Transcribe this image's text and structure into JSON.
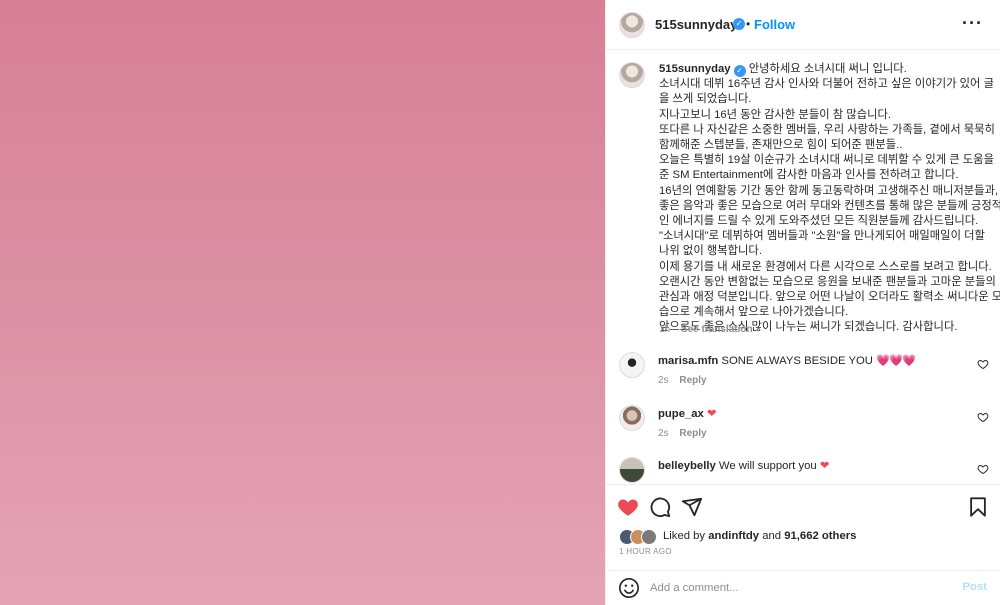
{
  "photo": {
    "colors": [
      "#d77f96",
      "#db8fa3",
      "#e4a4b5"
    ]
  },
  "header": {
    "username": "515sunnyday",
    "verified_icon": "verified-badge-icon",
    "dot": "•",
    "follow_label": "Follow",
    "more_icon": "more-options-icon",
    "more_glyph": "···"
  },
  "caption": {
    "username": "515sunnyday",
    "lines": [
      "안녕하세요 소녀시대 써니 입니다.",
      "소녀시대 데뷔 16주년 감사 인사와 더불어 전하고 싶은 이야기가 있어 글",
      "을 쓰게 되었습니다.",
      "지나고보니 16년 동안 감사한 분들이 참 많습니다.",
      "또다른 나 자신같은 소중한 멤버들, 우리 사랑하는 가족들, 곁에서 묵묵히",
      "함께해준 스텝분들, 존재만으로 힘이 되어준 팬분들..",
      "오늘은 특별히 19살 이순규가 소녀시대 써니로 데뷔할 수 있게 큰 도움을",
      "준 SM Entertainment에 감사한 마음과 인사를 전하려고 합니다.",
      "16년의 연예활동 기간 동안 함께 동고동락하며 고생해주신 매니저분들과,",
      "좋은 음악과 좋은 모습으로 여러 무대와 컨텐츠를 통해 많은 분들께 긍정적",
      "인 에너지를 드릴 수 있게 도와주셨던 모든 직원분들께 감사드립니다.",
      "\"소녀시대\"로 데뷔하여 멤버들과 \"소원\"을 만나게되어 매일매일이 더할",
      "나위 없이 행복합니다.",
      "이제 용기를 내 새로운 환경에서 다른 시각으로 스스로를 보려고 합니다.",
      "오랜시간 동안 변함없는 모습으로 응원을 보내준 팬분들과 고마운 분들의",
      "관심과 애정 덕분입니다. 앞으로 어떤 나날이 오더라도 활력소 써니다운 모",
      "습으로 계속해서 앞으로 나아가겠습니다.",
      "앞으로도 좋은 소식 많이 나누는 써니가 되겠습니다. 감사합니다."
    ],
    "time": "1h",
    "see_translation": "See translation"
  },
  "comments": [
    {
      "username": "marisa.mfn",
      "text": "SONE ALWAYS BESIDE YOU",
      "emoji": "💗💗💗",
      "time": "2s",
      "reply": "Reply"
    },
    {
      "username": "pupe_ax",
      "text": "",
      "emoji": "❤",
      "time": "2s",
      "reply": "Reply"
    },
    {
      "username": "belleybelly",
      "text": "We will support you",
      "emoji": "❤",
      "time": "",
      "reply": ""
    }
  ],
  "actions": {
    "like_icon": "heart-filled-icon",
    "comment_icon": "comment-bubble-icon",
    "share_icon": "share-paper-plane-icon",
    "save_icon": "bookmark-icon",
    "liked_by_prefix": "Liked by",
    "liked_by_user": "andinftdy",
    "and": "and",
    "others_count": "91,662 others",
    "timestamp": "1 HOUR AGO",
    "like_color": "#ed4956"
  },
  "add_comment": {
    "emoji_icon": "smiley-emoji-icon",
    "placeholder": "Add a comment...",
    "post_label": "Post"
  }
}
